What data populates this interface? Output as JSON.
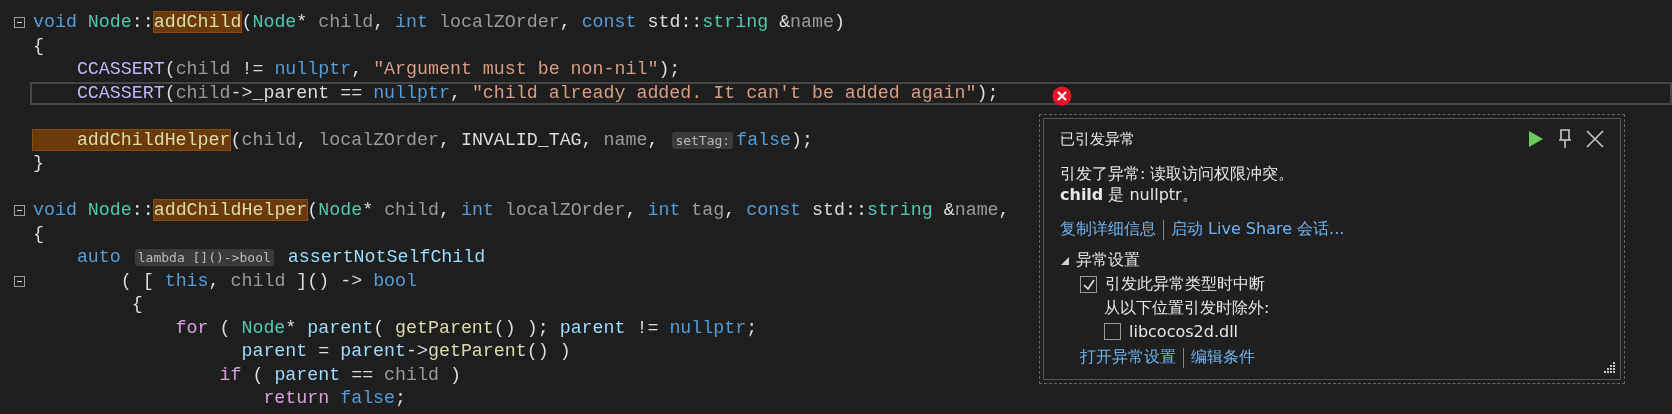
{
  "lines": [
    {
      "fold": true,
      "current": false,
      "tokens": [
        {
          "kind": "kw",
          "text": "void"
        },
        {
          "kind": "type",
          "text": " Node"
        },
        {
          "kind": "plain",
          "text": "::"
        },
        {
          "kind": "ref",
          "text": "addChild"
        },
        {
          "kind": "plain",
          "text": "("
        },
        {
          "kind": "type",
          "text": "Node"
        },
        {
          "kind": "plain",
          "text": "* "
        },
        {
          "kind": "param",
          "text": "child"
        },
        {
          "kind": "plain",
          "text": ", "
        },
        {
          "kind": "kw",
          "text": "int"
        },
        {
          "kind": "param",
          "text": " localZOrder"
        },
        {
          "kind": "plain",
          "text": ", "
        },
        {
          "kind": "kw",
          "text": "const"
        },
        {
          "kind": "plain",
          "text": " std::"
        },
        {
          "kind": "type",
          "text": "string"
        },
        {
          "kind": "plain",
          "text": " &"
        },
        {
          "kind": "param",
          "text": "name"
        },
        {
          "kind": "plain",
          "text": ")"
        }
      ]
    },
    {
      "fold": false,
      "current": false,
      "tokens": [
        {
          "kind": "plain",
          "text": "{"
        }
      ]
    },
    {
      "fold": false,
      "current": false,
      "tokens": [
        {
          "kind": "macro",
          "text": "    CCASSERT"
        },
        {
          "kind": "plain",
          "text": "("
        },
        {
          "kind": "param",
          "text": "child"
        },
        {
          "kind": "plain",
          "text": " != "
        },
        {
          "kind": "kw",
          "text": "nullptr"
        },
        {
          "kind": "plain",
          "text": ", "
        },
        {
          "kind": "str",
          "text": "\"Argument must be non-nil\""
        },
        {
          "kind": "plain",
          "text": ");"
        }
      ]
    },
    {
      "fold": false,
      "current": true,
      "tokens": [
        {
          "kind": "macro",
          "text": "    CCASSERT"
        },
        {
          "kind": "plain",
          "text": "("
        },
        {
          "kind": "param",
          "text": "child"
        },
        {
          "kind": "plain",
          "text": "->_parent == "
        },
        {
          "kind": "kw",
          "text": "nullptr"
        },
        {
          "kind": "plain",
          "text": ", "
        },
        {
          "kind": "str",
          "text": "\"child already added. It can't be added again\""
        },
        {
          "kind": "plain",
          "text": ");"
        }
      ]
    },
    {
      "fold": false,
      "current": false
    },
    {
      "fold": false,
      "current": false,
      "tokens": [
        {
          "kind": "ref",
          "text": "    addChildHelper"
        },
        {
          "kind": "plain",
          "text": "("
        },
        {
          "kind": "param",
          "text": "child"
        },
        {
          "kind": "plain",
          "text": ", "
        },
        {
          "kind": "param",
          "text": "localZOrder"
        },
        {
          "kind": "plain",
          "text": ", INVALID_TAG, "
        },
        {
          "kind": "param",
          "text": "name"
        },
        {
          "kind": "plain",
          "text": ", "
        },
        {
          "kind": "hint",
          "text": "setTag:"
        },
        {
          "kind": "kw",
          "text": "false"
        },
        {
          "kind": "plain",
          "text": ");"
        }
      ]
    },
    {
      "fold": false,
      "current": false,
      "tokens": [
        {
          "kind": "plain",
          "text": "}"
        }
      ]
    },
    {
      "fold": false,
      "current": false
    },
    {
      "fold": true,
      "current": false,
      "tokens": [
        {
          "kind": "kw",
          "text": "void"
        },
        {
          "kind": "type",
          "text": " Node"
        },
        {
          "kind": "plain",
          "text": "::"
        },
        {
          "kind": "ref",
          "text": "addChildHelper"
        },
        {
          "kind": "plain",
          "text": "("
        },
        {
          "kind": "type",
          "text": "Node"
        },
        {
          "kind": "plain",
          "text": "* "
        },
        {
          "kind": "param",
          "text": "child"
        },
        {
          "kind": "plain",
          "text": ", "
        },
        {
          "kind": "kw",
          "text": "int"
        },
        {
          "kind": "param",
          "text": " localZOrder"
        },
        {
          "kind": "plain",
          "text": ", "
        },
        {
          "kind": "kw",
          "text": "int"
        },
        {
          "kind": "param",
          "text": " tag"
        },
        {
          "kind": "plain",
          "text": ", "
        },
        {
          "kind": "kw",
          "text": "const"
        },
        {
          "kind": "plain",
          "text": " std::"
        },
        {
          "kind": "type",
          "text": "string"
        },
        {
          "kind": "plain",
          "text": " &"
        },
        {
          "kind": "param",
          "text": "name"
        },
        {
          "kind": "plain",
          "text": ","
        }
      ]
    },
    {
      "fold": false,
      "current": false,
      "tokens": [
        {
          "kind": "plain",
          "text": "{"
        }
      ]
    },
    {
      "fold": false,
      "current": false,
      "tokens": [
        {
          "kind": "kw",
          "text": "    auto "
        },
        {
          "kind": "hint",
          "text": "lambda []()->bool"
        },
        {
          "kind": "var",
          "text": " assertNotSelfChild"
        }
      ]
    },
    {
      "fold": true,
      "current": false,
      "tokens": [
        {
          "kind": "plain",
          "text": "        ( [ "
        },
        {
          "kind": "kw",
          "text": "this"
        },
        {
          "kind": "plain",
          "text": ", "
        },
        {
          "kind": "param",
          "text": "child"
        },
        {
          "kind": "plain",
          "text": " ]() -> "
        },
        {
          "kind": "kw",
          "text": "bool"
        }
      ]
    },
    {
      "fold": false,
      "current": false,
      "tokens": [
        {
          "kind": "plain",
          "text": "         {"
        }
      ]
    },
    {
      "fold": false,
      "current": false,
      "tokens": [
        {
          "kind": "ctrl",
          "text": "             for"
        },
        {
          "kind": "plain",
          "text": " ( "
        },
        {
          "kind": "type",
          "text": "Node"
        },
        {
          "kind": "plain",
          "text": "* "
        },
        {
          "kind": "var",
          "text": "parent"
        },
        {
          "kind": "plain",
          "text": "( "
        },
        {
          "kind": "fn",
          "text": "getParent"
        },
        {
          "kind": "plain",
          "text": "() ); "
        },
        {
          "kind": "var",
          "text": "parent"
        },
        {
          "kind": "plain",
          "text": " != "
        },
        {
          "kind": "kw",
          "text": "nullptr"
        },
        {
          "kind": "plain",
          "text": ";"
        }
      ]
    },
    {
      "fold": false,
      "current": false,
      "tokens": [
        {
          "kind": "var",
          "text": "                   parent"
        },
        {
          "kind": "plain",
          "text": " = "
        },
        {
          "kind": "var",
          "text": "parent"
        },
        {
          "kind": "plain",
          "text": "->"
        },
        {
          "kind": "fn",
          "text": "getParent"
        },
        {
          "kind": "plain",
          "text": "() )"
        }
      ]
    },
    {
      "fold": false,
      "current": false,
      "tokens": [
        {
          "kind": "ctrl",
          "text": "                 if"
        },
        {
          "kind": "plain",
          "text": " ( "
        },
        {
          "kind": "var",
          "text": "parent"
        },
        {
          "kind": "plain",
          "text": " == "
        },
        {
          "kind": "param",
          "text": "child"
        },
        {
          "kind": "plain",
          "text": " )"
        }
      ]
    },
    {
      "fold": false,
      "current": false,
      "tokens": [
        {
          "kind": "ctrl",
          "text": "                     return"
        },
        {
          "kind": "kw",
          "text": " false"
        },
        {
          "kind": "plain",
          "text": ";"
        }
      ]
    }
  ],
  "exception": {
    "title": "已引发异常",
    "message": "引发了异常: 读取访问权限冲突。",
    "detail": "**child** 是 nullptr。",
    "links": [
      "复制详细信息",
      "启动 Live Share 会话..."
    ],
    "settings": {
      "label": "异常设置",
      "expanded": true,
      "break_when_thrown": {
        "label": "引发此异常类型时中断",
        "checked": true
      },
      "except_label": "从以下位置引发时除外:",
      "modules": [
        {
          "label": "libcocos2d.dll",
          "checked": false
        }
      ]
    },
    "footer_links": [
      "打开异常设置",
      "编辑条件"
    ]
  }
}
